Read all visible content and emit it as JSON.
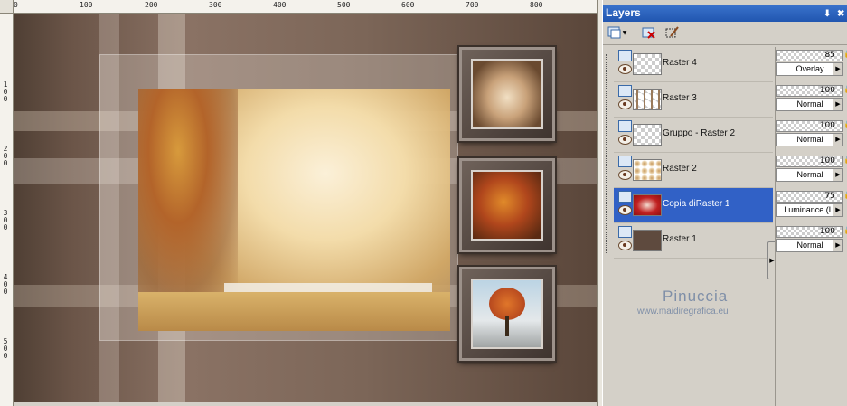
{
  "rulers": {
    "top_labels": [
      "0",
      "100",
      "200",
      "300",
      "400",
      "500",
      "600",
      "700",
      "800"
    ],
    "left_labels": [
      "1 0 0",
      "2 0 0",
      "3 0 0",
      "4 0 0",
      "5 0 0"
    ]
  },
  "layers_panel": {
    "title": "Layers",
    "pin_icon": "pin-icon",
    "close_icon": "close-icon",
    "layers": [
      {
        "name": "Raster 4",
        "opacity": "85",
        "blend": "Overlay",
        "selected": false
      },
      {
        "name": "Raster 3",
        "opacity": "100",
        "blend": "Normal",
        "selected": false
      },
      {
        "name": "Gruppo - Raster 2",
        "opacity": "100",
        "blend": "Normal",
        "selected": false
      },
      {
        "name": "Raster 2",
        "opacity": "100",
        "blend": "Normal",
        "selected": false
      },
      {
        "name": "Copia diRaster 1",
        "opacity": "75",
        "blend": "Luminance (L)",
        "selected": true
      },
      {
        "name": "Raster 1",
        "opacity": "100",
        "blend": "Normal",
        "selected": false
      }
    ]
  },
  "watermark": {
    "name": "Pinuccia",
    "url": "www.maidiregrafica.eu"
  },
  "colors": {
    "title_bar": "#2156b0",
    "selection": "#3161c6",
    "panel_bg": "#d4d0c8"
  }
}
